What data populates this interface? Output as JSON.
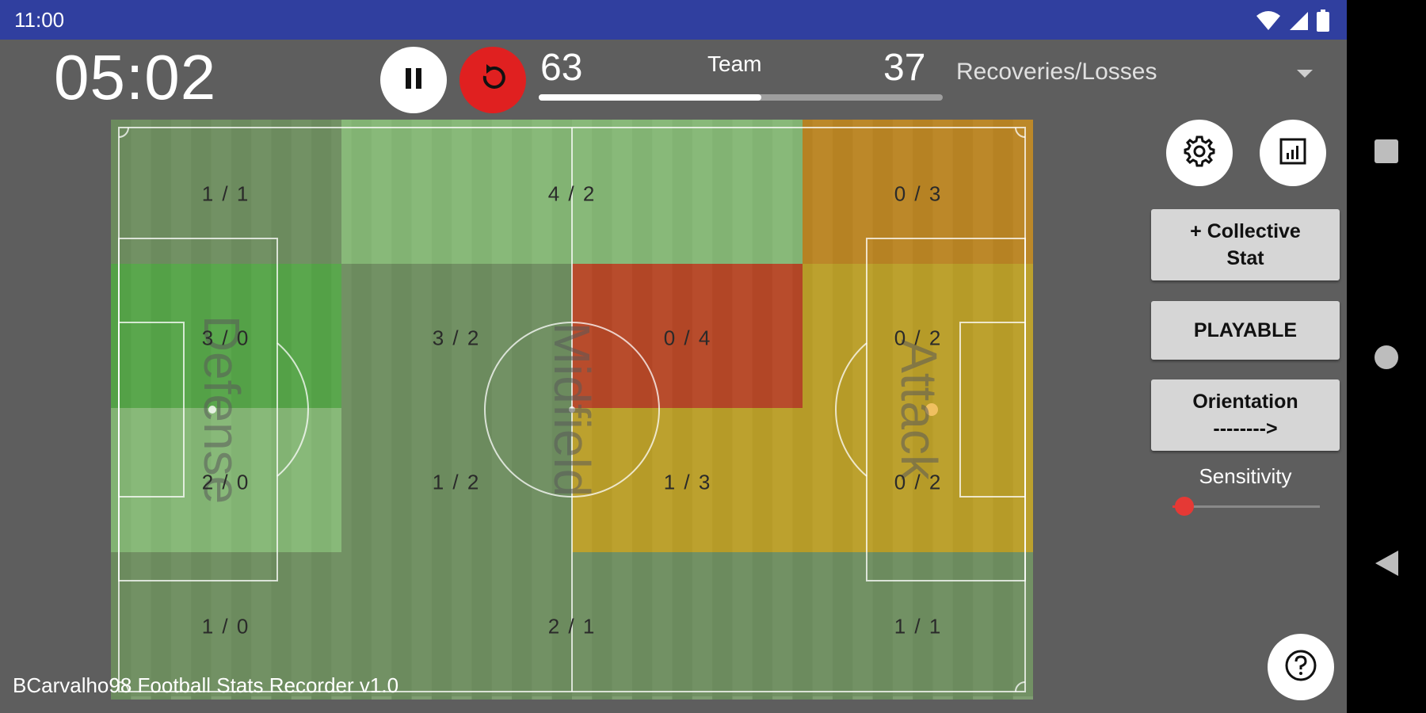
{
  "status_bar": {
    "time": "11:00"
  },
  "timer": "05:02",
  "score": {
    "left": "63",
    "label": "Team",
    "right": "37",
    "progress": 0.55
  },
  "stat_selector": {
    "value": "Recoveries/Losses"
  },
  "pitch": {
    "colors": {
      "grass_dark": "#6a8a5e",
      "grass_light": "#7f9d72"
    },
    "zones": [
      {
        "label": "1 / 1",
        "color": "#6e8c5e"
      },
      {
        "label": "4 / 2",
        "color": "#8cc47c"
      },
      {
        "label": "0 / 3",
        "color": "#d4800c"
      },
      {
        "label": "3 / 0",
        "color": "#4caa3e"
      },
      {
        "label": "3 / 2",
        "color": "#6e8c5e"
      },
      {
        "label": "0 / 4",
        "color": "#cf2c10"
      },
      {
        "label": "0 / 2",
        "color": "#d4a214"
      },
      {
        "label": "2 / 0",
        "color": "#8cc47c"
      },
      {
        "label": "1 / 2",
        "color": "#6e8c5e"
      },
      {
        "label": "1 / 3",
        "color": "#d4a214"
      },
      {
        "label": "0 / 2",
        "color": "#d4a214"
      },
      {
        "label": "1 / 0",
        "color": "#6e8c5e"
      },
      {
        "label": "2 / 1",
        "color": "#6e8c5e"
      },
      {
        "label": "1 / 1",
        "color": "#6e8c5e"
      }
    ],
    "areas": {
      "defense": "Defense",
      "midfield": "Midfield",
      "attack": "Attack"
    }
  },
  "footer": "BCarvalho98 Football Stats Recorder v1.0",
  "side_panel": {
    "collective_line1": "+ Collective",
    "collective_line2": "Stat",
    "playable": "PLAYABLE",
    "orientation_line1": "Orientation",
    "orientation_line2": "-------->",
    "sensitivity_label": "Sensitivity",
    "sensitivity_value": 0.08
  },
  "icons": [
    "pause-icon",
    "reset-icon",
    "gear-icon",
    "report-icon",
    "help-icon",
    "wifi-icon",
    "signal-icon",
    "battery-icon",
    "recent-apps-icon",
    "home-icon",
    "back-icon"
  ],
  "accent_colors": {
    "status_bar": "#303f9f",
    "reset": "#e02020",
    "slider": "#e53935"
  }
}
